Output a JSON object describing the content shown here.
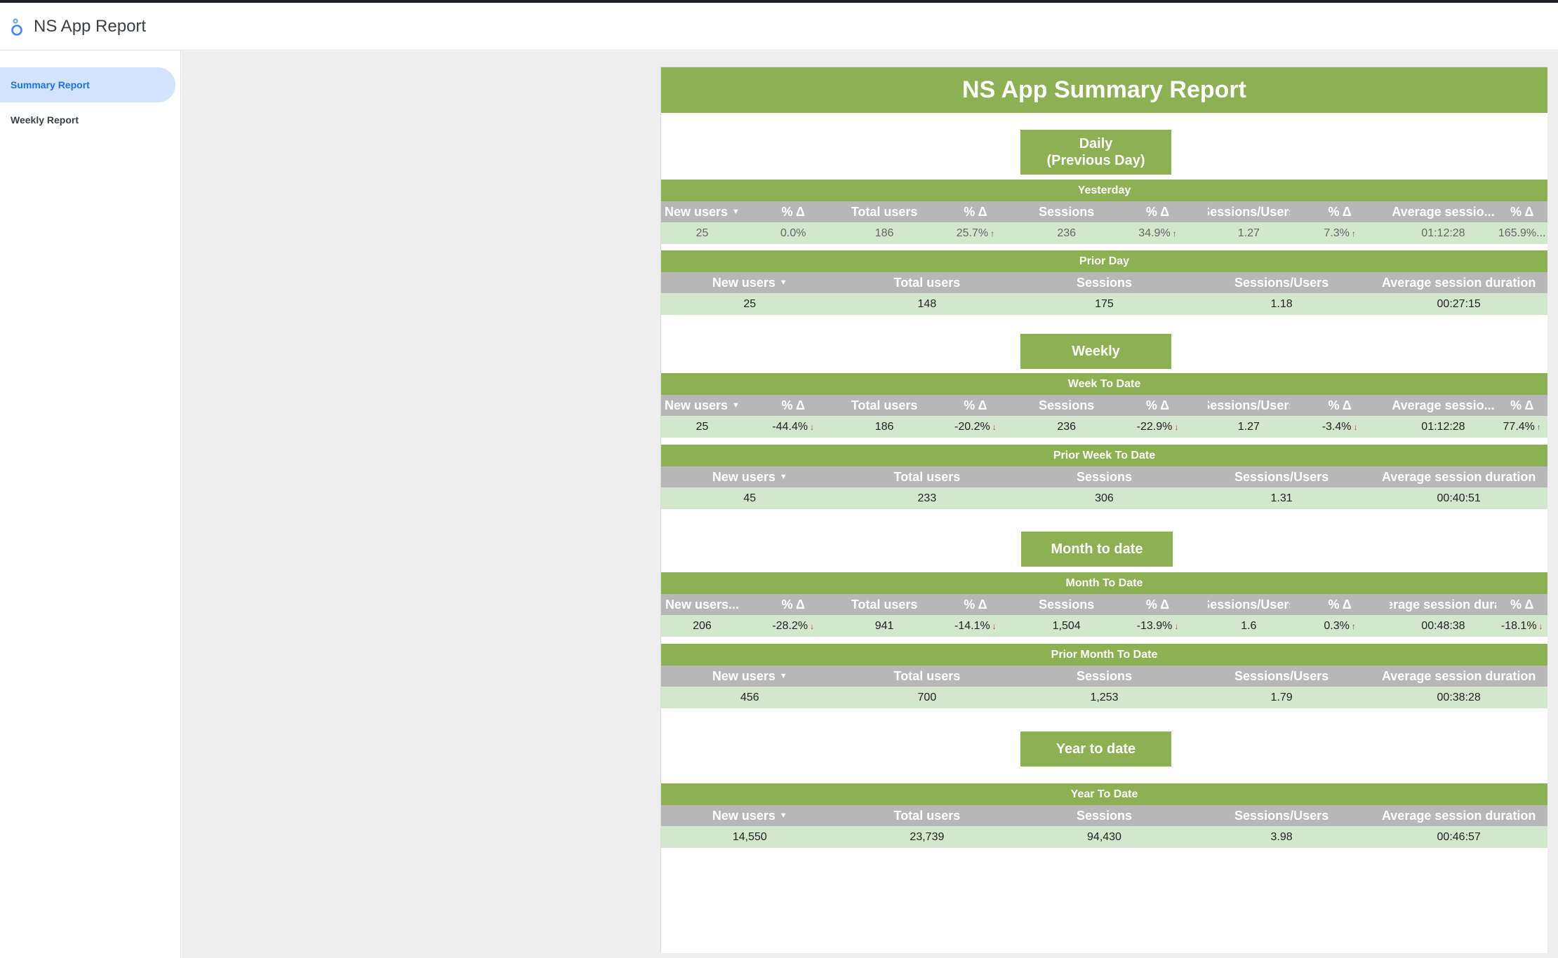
{
  "app": {
    "title": "NS App Report",
    "logo_icon": "looker-studio-logo-icon"
  },
  "sidebar": {
    "items": [
      {
        "label": "Summary Report",
        "active": true
      },
      {
        "label": "Weekly Report",
        "active": false
      }
    ]
  },
  "report": {
    "title": "NS App Summary Report",
    "sections": {
      "daily": "Daily\n(Previous Day)",
      "weekly": "Weekly",
      "month": "Month to date",
      "year": "Year to date"
    },
    "tables": {
      "yesterday": {
        "title": "Yesterday",
        "headers": [
          "New users",
          "% Δ",
          "Total users",
          "% Δ",
          "Sessions",
          "% Δ",
          "Sessions/Users",
          "% Δ",
          "Average sessio...",
          "% Δ"
        ],
        "values": [
          "25",
          "0.0%",
          "186",
          "25.7%",
          "236",
          "34.9%",
          "1.27",
          "7.3%",
          "01:12:28",
          "165.9%..."
        ],
        "trend": [
          "",
          "",
          "",
          "up",
          "",
          "up",
          "",
          "up",
          "",
          ""
        ]
      },
      "prior_day": {
        "title": "Prior Day",
        "headers": [
          "New users",
          "Total users",
          "Sessions",
          "Sessions/Users",
          "Average session duration"
        ],
        "values": [
          "25",
          "148",
          "175",
          "1.18",
          "00:27:15"
        ]
      },
      "week_to_date": {
        "title": "Week To Date",
        "headers": [
          "New users",
          "% Δ",
          "Total users",
          "% Δ",
          "Sessions",
          "% Δ",
          "Sessions/Users",
          "% Δ",
          "Average sessio...",
          "% Δ"
        ],
        "values": [
          "25",
          "-44.4%",
          "186",
          "-20.2%",
          "236",
          "-22.9%",
          "1.27",
          "-3.4%",
          "01:12:28",
          "77.4%"
        ],
        "trend": [
          "",
          "down",
          "",
          "down",
          "",
          "down",
          "",
          "down",
          "",
          "up"
        ]
      },
      "prior_week": {
        "title": "Prior Week To Date",
        "headers": [
          "New users",
          "Total users",
          "Sessions",
          "Sessions/Users",
          "Average session duration"
        ],
        "values": [
          "45",
          "233",
          "306",
          "1.31",
          "00:40:51"
        ]
      },
      "month_to_date": {
        "title": "Month To Date",
        "headers": [
          "New users...",
          "% Δ",
          "Total users",
          "% Δ",
          "Sessions",
          "% Δ",
          "Sessions/Users",
          "% Δ",
          "Average session durat...",
          "% Δ"
        ],
        "values": [
          "206",
          "-28.2%",
          "941",
          "-14.1%",
          "1,504",
          "-13.9%",
          "1.6",
          "0.3%",
          "00:48:38",
          "-18.1%"
        ],
        "trend": [
          "",
          "down",
          "",
          "down",
          "",
          "down",
          "",
          "up",
          "",
          "down"
        ]
      },
      "prior_month": {
        "title": "Prior Month To Date",
        "headers": [
          "New users",
          "Total users",
          "Sessions",
          "Sessions/Users",
          "Average session duration"
        ],
        "values": [
          "456",
          "700",
          "1,253",
          "1.79",
          "00:38:28"
        ]
      },
      "year_to_date": {
        "title": "Year To Date",
        "headers": [
          "New users",
          "Total users",
          "Sessions",
          "Sessions/Users",
          "Average session duration"
        ],
        "values": [
          "14,550",
          "23,739",
          "94,430",
          "3.98",
          "00:46:57"
        ]
      }
    }
  },
  "colors": {
    "green": "#8bb152",
    "header_gray": "#b7b7b7",
    "row_green": "#d2e7cc"
  }
}
